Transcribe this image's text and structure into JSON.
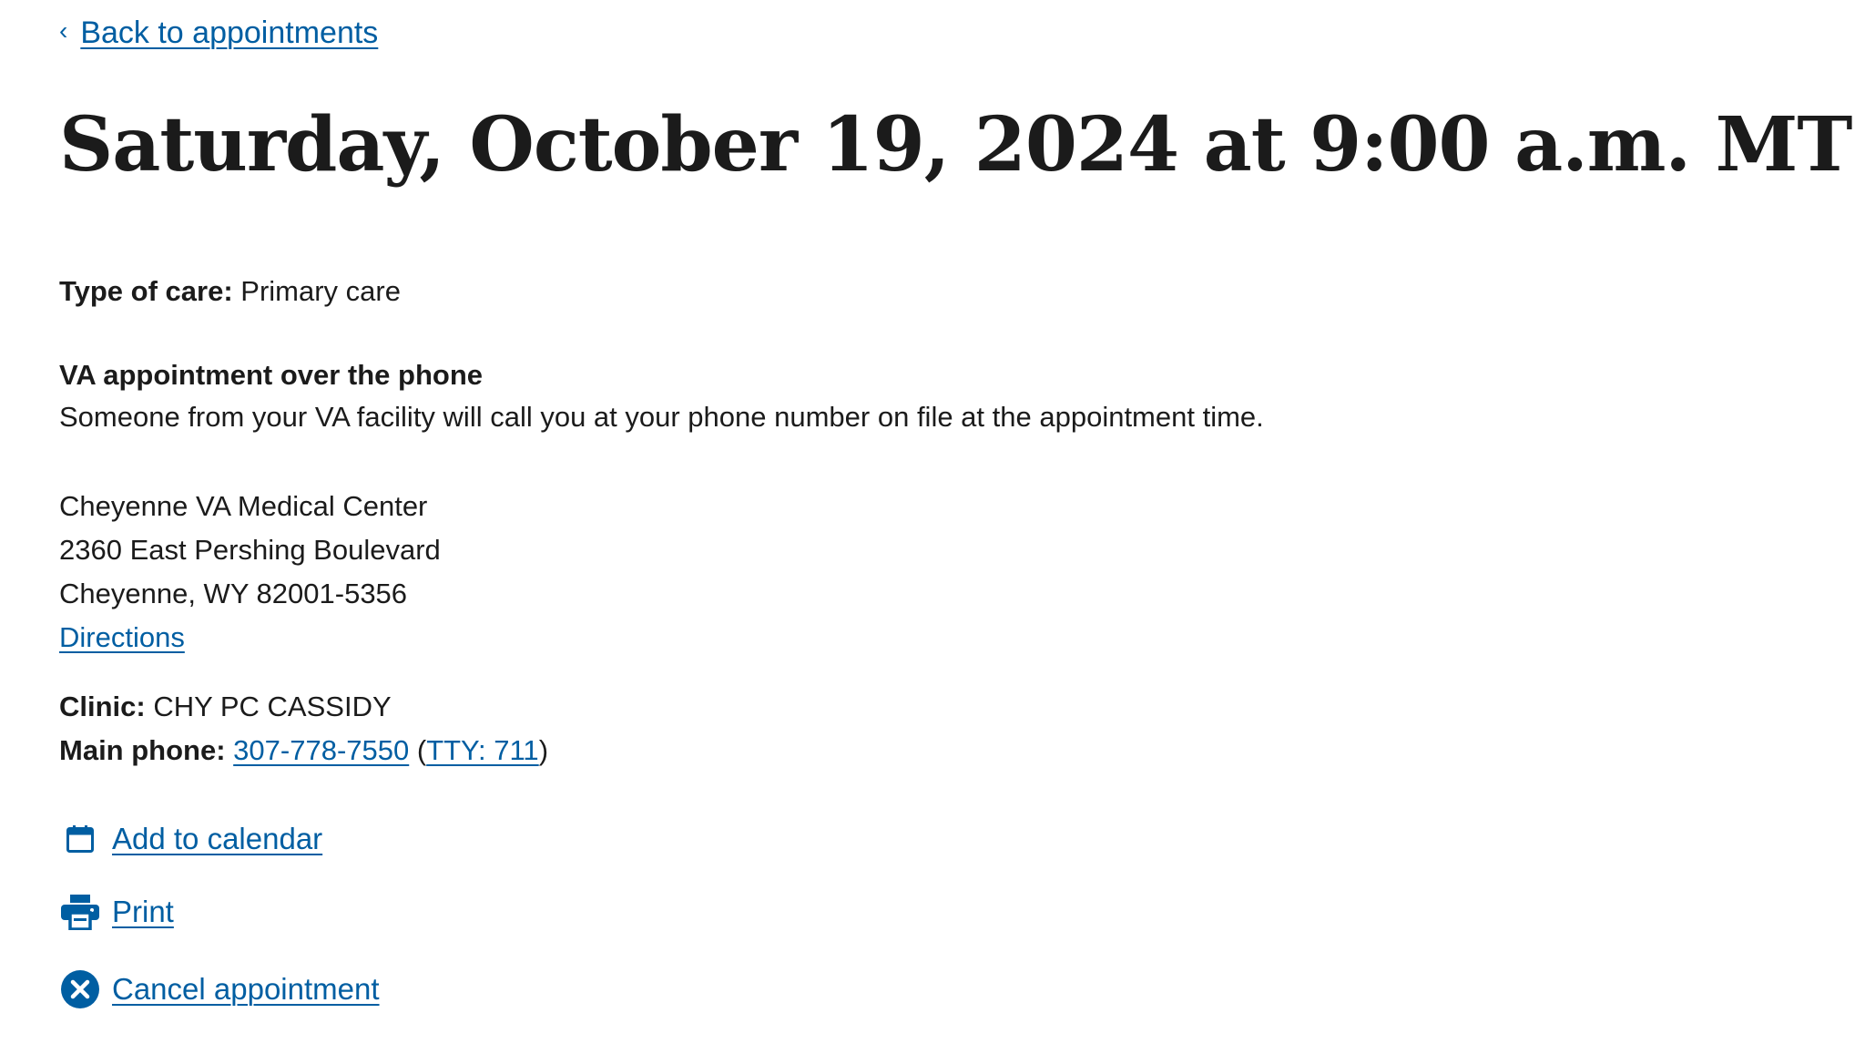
{
  "nav": {
    "back_label": "Back to appointments"
  },
  "appointment": {
    "title": "Saturday, October 19, 2024 at 9:00 a.m. MT",
    "type_of_care_label": "Type of care:",
    "type_of_care_value": "Primary care",
    "modality_heading": "VA appointment over the phone",
    "modality_description": "Someone from your VA facility will call you at your phone number on file at the appointment time."
  },
  "facility": {
    "name": "Cheyenne VA Medical Center",
    "street": "2360 East Pershing Boulevard",
    "city_state_zip": "Cheyenne, WY 82001-5356",
    "directions_label": "Directions",
    "clinic_label": "Clinic:",
    "clinic_value": "CHY PC CASSIDY",
    "phone_label": "Main phone:",
    "phone_value": "307-778-7550",
    "tty_value": "TTY: 711"
  },
  "actions": {
    "add_to_calendar_label": "Add to calendar",
    "print_label": "Print",
    "cancel_label": "Cancel appointment"
  },
  "icons": {
    "back": "chevron-left-icon",
    "calendar": "calendar-icon",
    "print": "printer-icon",
    "cancel": "cancel-circle-icon"
  },
  "colors": {
    "link": "#005ea2",
    "text": "#1b1b1b",
    "background": "#ffffff"
  }
}
